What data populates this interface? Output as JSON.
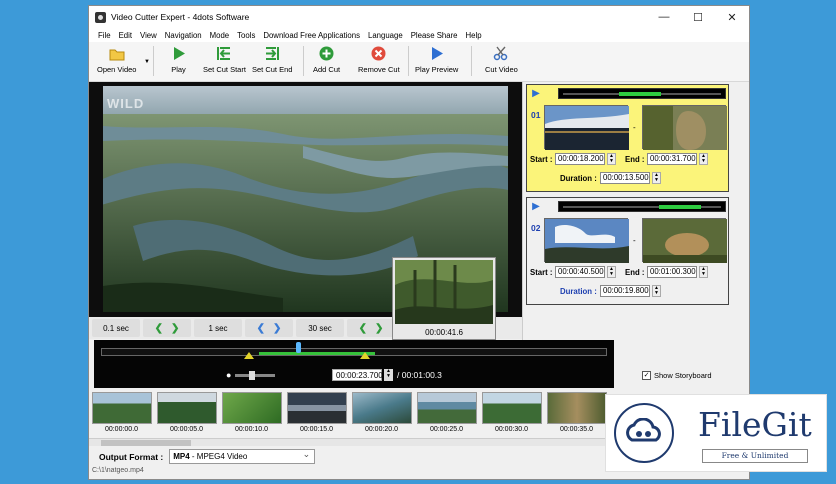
{
  "window": {
    "title": "Video Cutter Expert   -   4dots Software"
  },
  "menu": [
    "File",
    "Edit",
    "View",
    "Navigation",
    "Mode",
    "Tools",
    "Download Free Applications",
    "Language",
    "Please Share",
    "Help"
  ],
  "toolbar": {
    "open_video": "Open Video",
    "play": "Play",
    "set_cut_start": "Set Cut Start",
    "set_cut_end": "Set Cut End",
    "add_cut": "Add Cut",
    "remove_cut": "Remove Cut",
    "play_preview": "Play Preview",
    "cut_video": "Cut Video"
  },
  "video": {
    "watermark": "WILD",
    "preview_time": "00:00:41.6"
  },
  "steps": [
    "0.1 sec",
    "1 sec",
    "30 sec"
  ],
  "segments": [
    {
      "number": "01",
      "start_label": "Start :",
      "start": "00:00:18.200",
      "end_label": "End :",
      "end": "00:00:31.700",
      "duration_label": "Duration :",
      "duration": "00:00:13.500"
    },
    {
      "number": "02",
      "start_label": "Start :",
      "start": "00:00:40.500",
      "end_label": "End :",
      "end": "00:01:00.300",
      "duration_label": "Duration :",
      "duration": "00:00:19.800"
    }
  ],
  "timeline": {
    "current": "00:00:23.700",
    "total": "/ 00:01:00.3"
  },
  "storyboard": {
    "show_label": "Show Storyboard",
    "frames": [
      "00:00:00.0",
      "00:00:05.0",
      "00:00:10.0",
      "00:00:15.0",
      "00:00:20.0",
      "00:00:25.0",
      "00:00:30.0",
      "00:00:35.0"
    ]
  },
  "output": {
    "label": "Output Format :",
    "format_bold": "MP4",
    "format_rest": " - MPEG4 Video"
  },
  "status": {
    "path": "C:\\1\\natgeo.mp4"
  },
  "badge": {
    "brand": "FileGit",
    "tagline": "Free & Unlimited"
  },
  "colors": {
    "selected_segment": "#fbf47a",
    "cut_range": "#36c23b",
    "page_bg": "#3d9ad8"
  }
}
